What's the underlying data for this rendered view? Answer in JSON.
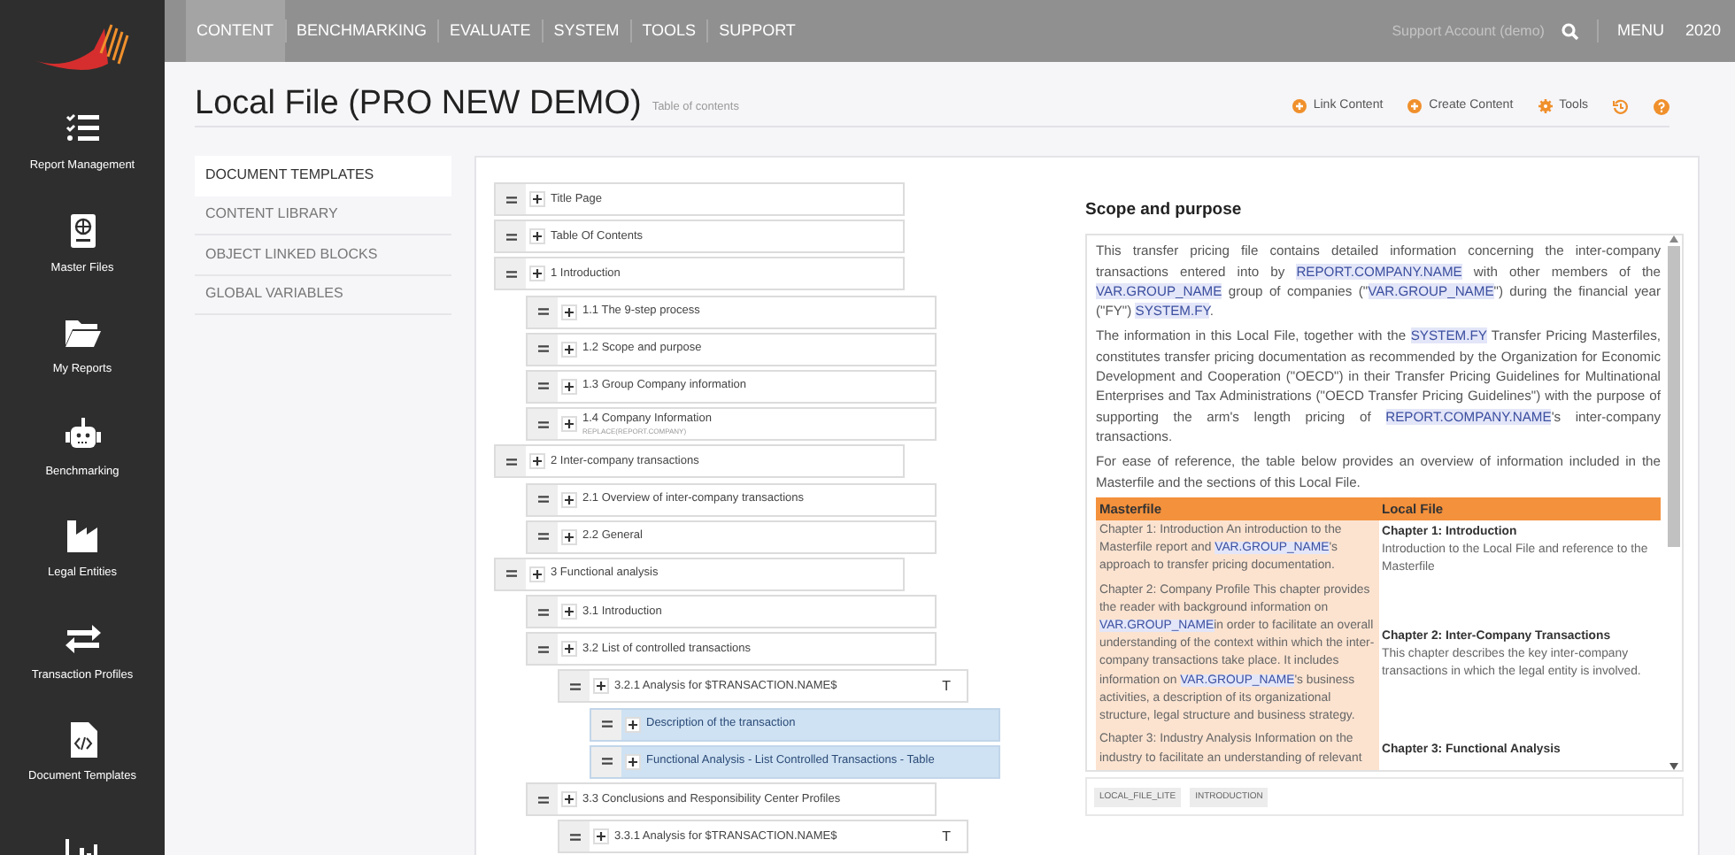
{
  "sidebar": {
    "items": [
      {
        "kind": "checklist",
        "label": "Report Management"
      },
      {
        "kind": "globe-doc",
        "label": "Master Files"
      },
      {
        "kind": "folder",
        "label": "My Reports"
      },
      {
        "kind": "robot",
        "label": "Benchmarking"
      },
      {
        "kind": "factory",
        "label": "Legal Entities"
      },
      {
        "kind": "arrows",
        "label": "Transaction Profiles"
      },
      {
        "kind": "code-doc",
        "label": "Document Templates"
      },
      {
        "kind": "chart"
      }
    ]
  },
  "top_nav": {
    "tabs": [
      {
        "label": "CONTENT",
        "selected": true
      },
      {
        "label": "BENCHMARKING",
        "selected": false
      },
      {
        "label": "EVALUATE",
        "selected": false
      },
      {
        "label": "SYSTEM",
        "selected": false
      },
      {
        "label": "TOOLS",
        "selected": false
      },
      {
        "label": "SUPPORT",
        "selected": false
      }
    ],
    "account": "Support Account (demo)",
    "menu": "MENU",
    "year": "2020"
  },
  "header": {
    "title": "Local File (PRO NEW DEMO)",
    "subtitle": "Table of contents",
    "actions": [
      {
        "kind": "link",
        "label": "Link Content"
      },
      {
        "kind": "create",
        "label": "Create Content"
      },
      {
        "kind": "tools",
        "label": "Tools"
      },
      {
        "kind": "history"
      },
      {
        "kind": "help"
      }
    ]
  },
  "side_menu": [
    {
      "label": "DOCUMENT TEMPLATES",
      "selected": true
    },
    {
      "label": "CONTENT LIBRARY",
      "selected": false
    },
    {
      "label": "OBJECT LINKED BLOCKS",
      "selected": false
    },
    {
      "label": "GLOBAL VARIABLES",
      "selected": false
    }
  ],
  "tree": [
    {
      "label": "Title Page",
      "selected": false
    },
    {
      "label": "Table Of Contents",
      "selected": false
    },
    {
      "label": "1 Introduction",
      "selected": false,
      "children": [
        {
          "label": "1.1 The 9-step process",
          "selected": false
        },
        {
          "label": "1.2 Scope and purpose",
          "selected": false
        },
        {
          "label": "1.3 Group Company information",
          "selected": false
        },
        {
          "label": "1.4 Company Information",
          "note": "REPLACE(REPORT.COMPANY)",
          "selected": false
        }
      ]
    },
    {
      "label": "2 Inter-company transactions",
      "selected": false,
      "children": [
        {
          "label": "2.1 Overview of inter-company transactions",
          "selected": false
        },
        {
          "label": "2.2 General",
          "selected": false
        }
      ]
    },
    {
      "label": "3 Functional analysis",
      "selected": false,
      "children": [
        {
          "label": "3.1 Introduction",
          "selected": false
        },
        {
          "label": "3.2 List of controlled transactions",
          "selected": false,
          "children": [
            {
              "label": "3.2.1 Analysis for $TRANSACTION.NAME$",
              "marker": "T",
              "selected": false,
              "children": [
                {
                  "label": "Description of the transaction",
                  "selected": true
                },
                {
                  "label": "Functional Analysis - List Controlled Transactions - Table",
                  "selected": true
                }
              ]
            }
          ]
        },
        {
          "label": "3.3 Conclusions and Responsibility Center Profiles",
          "selected": false,
          "children": [
            {
              "label": "3.3.1 Analysis for $TRANSACTION.NAME$",
              "marker": "T",
              "selected": false
            }
          ]
        }
      ]
    }
  ],
  "preview": {
    "title": "Scope and purpose",
    "paragraphs": [
      [
        {
          "kind": "text",
          "t": "This transfer pricing file contains detailed information concerning the inter-company transactions entered into by "
        },
        {
          "kind": "variable",
          "t": "REPORT.COMPANY.NAME"
        },
        {
          "kind": "text",
          "t": " with other members of the "
        },
        {
          "kind": "variable",
          "t": "VAR.GROUP_NAME"
        },
        {
          "kind": "text",
          "t": " group of companies (\""
        },
        {
          "kind": "variable",
          "t": "VAR.GROUP_NAME"
        },
        {
          "kind": "text",
          "t": "\") during the financial year (\"FY\") "
        },
        {
          "kind": "variable",
          "t": "SYSTEM.FY"
        },
        {
          "kind": "text",
          "t": "."
        }
      ],
      [
        {
          "kind": "text",
          "t": "The information in this Local File, together with the "
        },
        {
          "kind": "variable",
          "t": "SYSTEM.FY"
        },
        {
          "kind": "text",
          "t": " Transfer Pricing Masterfiles, constitutes transfer pricing documentation as recommended by the Organization for Economic Development and Cooperation (\"OECD\") in their Transfer Pricing Guidelines for Multinational Enterprises and Tax Administrations (\"OECD Transfer Pricing Guidelines\") with the purpose of supporting the arm's length pricing of "
        },
        {
          "kind": "variable",
          "t": "REPORT.COMPANY.NAME"
        },
        {
          "kind": "text",
          "t": "'s inter-company transactions."
        }
      ],
      [
        {
          "kind": "text",
          "t": "For ease of reference, the table below provides an overview of information included in the Masterfile and the sections of this Local File."
        }
      ]
    ],
    "table": {
      "columns": [
        "Masterfile",
        "Local File"
      ],
      "rows": [
        {
          "masterfile": [
            {
              "kind": "text",
              "t": "Chapter 1: Introduction An introduction to the Masterfile report and "
            },
            {
              "kind": "variable",
              "t": "VAR.GROUP_NAME"
            },
            {
              "kind": "text",
              "t": "'s approach to transfer pricing documentation."
            }
          ],
          "local_heading": "Chapter 1: Introduction",
          "local_text": "Introduction to the Local File and reference to the Masterfile"
        },
        {
          "masterfile": [
            {
              "kind": "text",
              "t": "Chapter 2: Company Profile This chapter provides the reader with background information on "
            },
            {
              "kind": "variable",
              "t": "VAR.GROUP_NAME"
            },
            {
              "kind": "text",
              "t": "in order to facilitate an overall understanding of the context within which the inter-company transactions take place. It includes information on "
            },
            {
              "kind": "variable",
              "t": "VAR.GROUP_NAME"
            },
            {
              "kind": "text",
              "t": "'s business activities, a description of its organizational structure, legal structure and business strategy."
            }
          ],
          "local_heading": "Chapter 2: Inter-Company Transactions",
          "local_text": "This chapter describes the key inter-company transactions in which the legal entity is involved."
        },
        {
          "masterfile": [
            {
              "kind": "text",
              "t": "Chapter 3: Industry Analysis Information on the industry to facilitate an understanding of relevant"
            }
          ],
          "local_heading": "Chapter 3: Functional Analysis"
        }
      ]
    },
    "tags": [
      "LOCAL_FILE_LITE",
      "INTRODUCTION"
    ]
  }
}
